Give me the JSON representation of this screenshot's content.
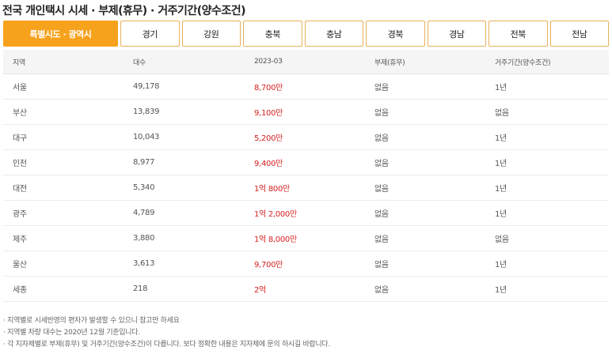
{
  "page": {
    "title": "전국 개인택시 시세 · 부제(휴무) · 거주기간(양수조건)"
  },
  "tabs": [
    {
      "label": "특별시도 · 광역시",
      "active": true
    },
    {
      "label": "경기",
      "active": false
    },
    {
      "label": "강원",
      "active": false
    },
    {
      "label": "충북",
      "active": false
    },
    {
      "label": "충남",
      "active": false
    },
    {
      "label": "경북",
      "active": false
    },
    {
      "label": "경남",
      "active": false
    },
    {
      "label": "전북",
      "active": false
    },
    {
      "label": "전남",
      "active": false
    }
  ],
  "table": {
    "headers": [
      "지역",
      "대수",
      "2023-03",
      "부제(휴무)",
      "거주기간(양수조건)"
    ],
    "rows": [
      {
        "region": "서울",
        "count": "49,178",
        "price": "8,700만",
        "rest": "없음",
        "residence": "1년"
      },
      {
        "region": "부산",
        "count": "13,839",
        "price": "9,100만",
        "rest": "없음",
        "residence": "없음"
      },
      {
        "region": "대구",
        "count": "10,043",
        "price": "5,200만",
        "rest": "없음",
        "residence": "1년"
      },
      {
        "region": "인천",
        "count": "8,977",
        "price": "9,400만",
        "rest": "없음",
        "residence": "1년"
      },
      {
        "region": "대전",
        "count": "5,340",
        "price": "1억 800만",
        "rest": "없음",
        "residence": "1년"
      },
      {
        "region": "광주",
        "count": "4,789",
        "price": "1억 2,000만",
        "rest": "없음",
        "residence": "1년"
      },
      {
        "region": "제주",
        "count": "3,880",
        "price": "1억 8,000만",
        "rest": "없음",
        "residence": "없음"
      },
      {
        "region": "울산",
        "count": "3,613",
        "price": "9,700만",
        "rest": "없음",
        "residence": "1년"
      },
      {
        "region": "세종",
        "count": "218",
        "price": "2억",
        "rest": "없음",
        "residence": "1년"
      }
    ]
  },
  "notes": [
    "· 지역별로 시세반영의 편차가 발생할 수 있으니 참고만 하세요",
    "· 지역별 차량 대수는 2020년 12월 기준입니다.",
    "· 각 지자체별로 부제(휴무) 및 거주기간(양수조건)이 다릅니다.  보다 정확한 내용은 지자체에 문의 하시길 바랍니다."
  ],
  "colors": {
    "accent": "#f7a21c",
    "tab_border": "#e6b25a",
    "price": "#d61f1f"
  }
}
